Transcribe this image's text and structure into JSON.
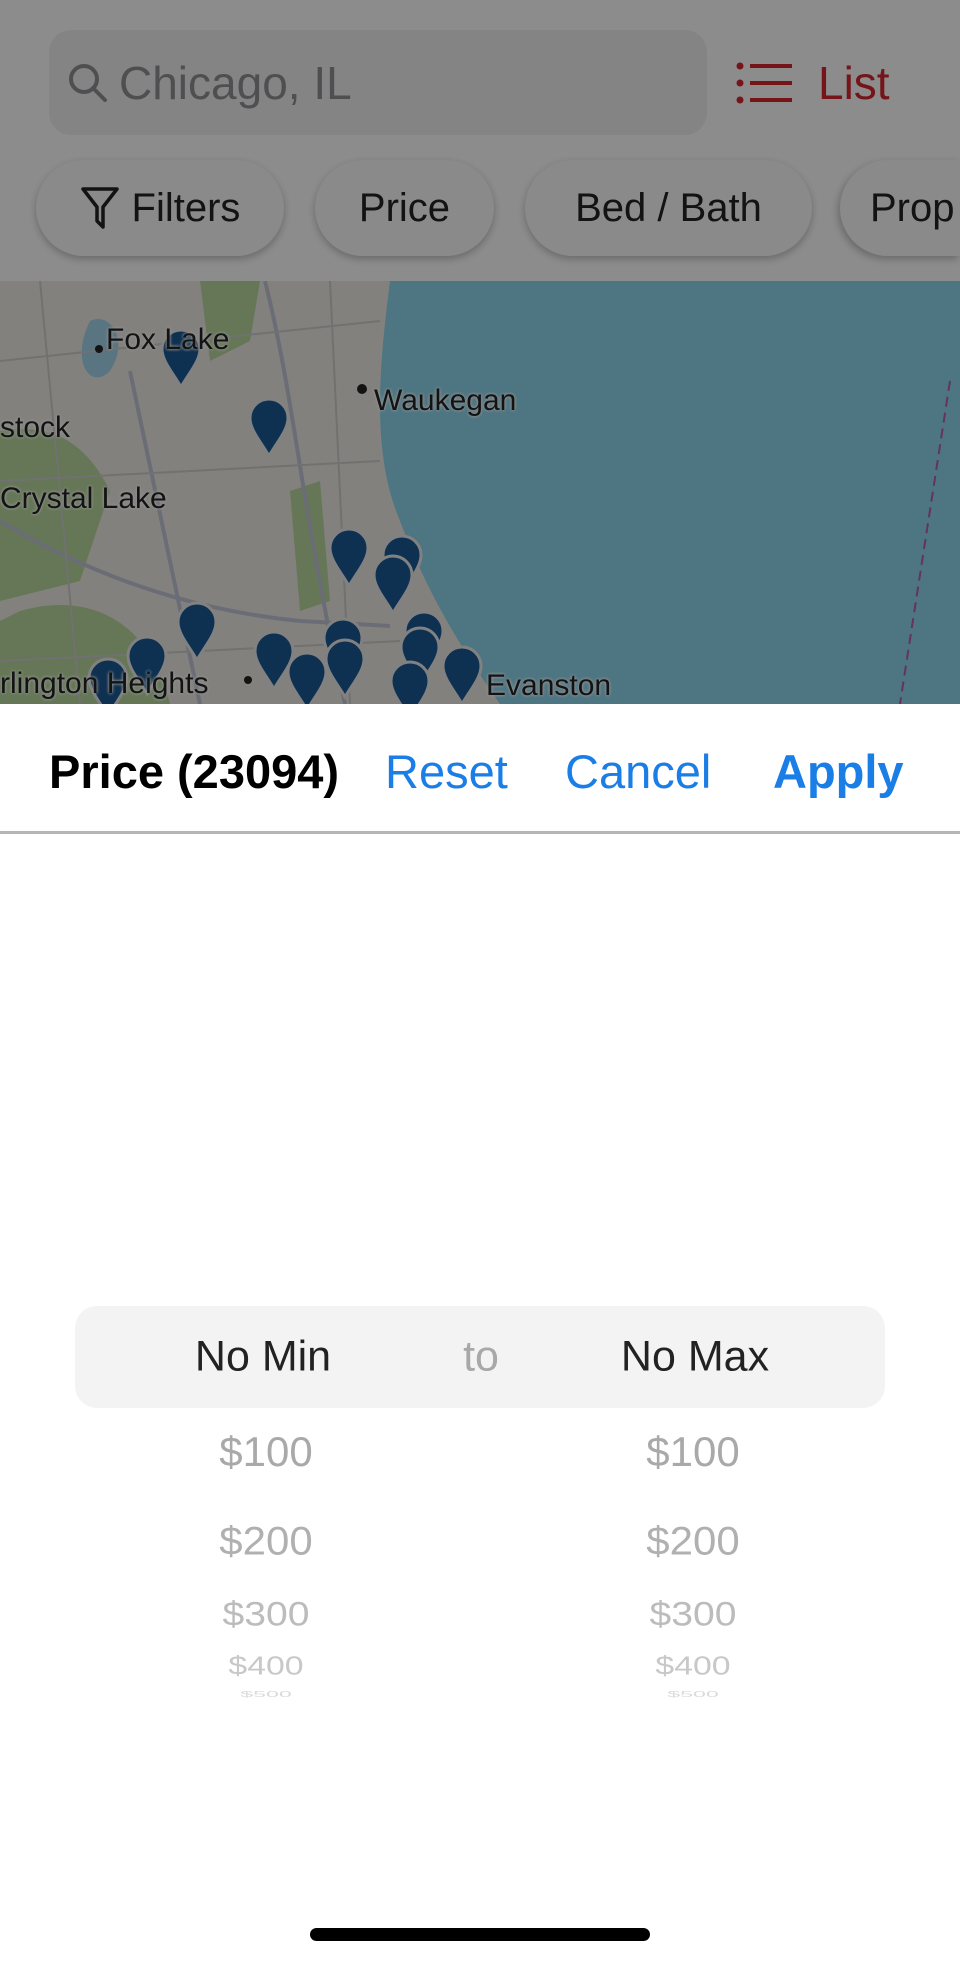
{
  "search": {
    "value": "Chicago, IL",
    "icon": "search-icon"
  },
  "list_button": {
    "label": "List",
    "icon": "list-icon",
    "color": "#d0262d"
  },
  "chips": [
    {
      "label": "Filters",
      "icon": "filter-icon"
    },
    {
      "label": "Price"
    },
    {
      "label": "Bed / Bath"
    },
    {
      "label": "Prop"
    }
  ],
  "map": {
    "labels": [
      "Fox Lake",
      "Waukegan",
      "stock",
      "Crystal Lake",
      "rlington Heights",
      "Evanston"
    ],
    "pin_color": "#1a5790",
    "water_color": "#8ad2e8"
  },
  "sheet": {
    "title": "Price (23094)",
    "reset": "Reset",
    "cancel": "Cancel",
    "apply": "Apply",
    "accent": "#1a7ee6"
  },
  "picker": {
    "min_selected": "No Min",
    "separator": "to",
    "max_selected": "No Max",
    "min_options": [
      "$100",
      "$200",
      "$300",
      "$400",
      "$500"
    ],
    "max_options": [
      "$100",
      "$200",
      "$300",
      "$400",
      "$500"
    ]
  }
}
